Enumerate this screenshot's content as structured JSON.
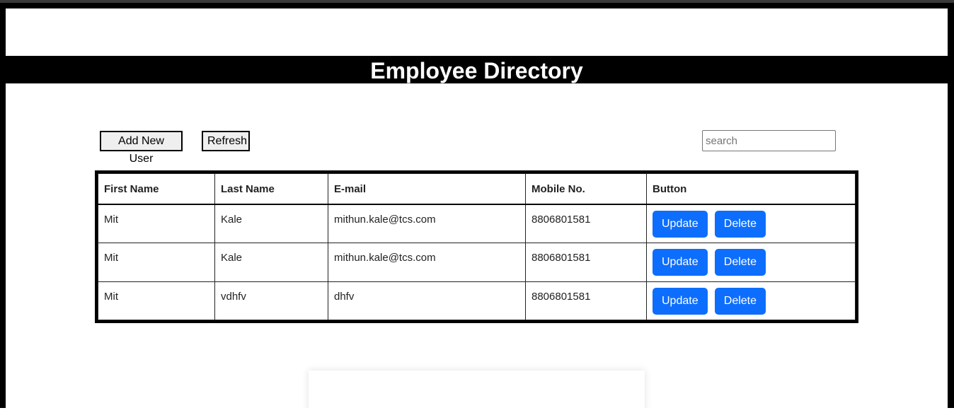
{
  "header": {
    "title": "Employee Directory"
  },
  "toolbar": {
    "add_label": "Add New User",
    "refresh_label": "Refresh",
    "search_placeholder": "search"
  },
  "table": {
    "columns": [
      "First Name",
      "Last Name",
      "E-mail",
      "Mobile No.",
      "Button"
    ],
    "rows": [
      {
        "first": "Mit",
        "last": "Kale",
        "email": "mithun.kale@tcs.com",
        "mobile": "8806801581"
      },
      {
        "first": "Mit",
        "last": "Kale",
        "email": "mithun.kale@tcs.com",
        "mobile": "8806801581"
      },
      {
        "first": "Mit",
        "last": "vdhfv",
        "email": "dhfv",
        "mobile": "8806801581"
      }
    ],
    "update_label": "Update",
    "delete_label": "Delete"
  },
  "colors": {
    "primary": "#0d6efd",
    "title_bg": "#000000",
    "title_fg": "#ffffff"
  }
}
